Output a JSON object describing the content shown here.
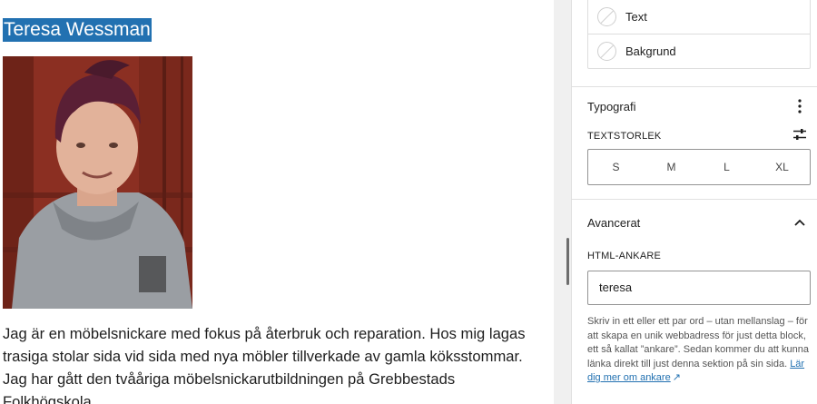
{
  "editor": {
    "heading": "Teresa Wessman",
    "photo_alt": "",
    "paragraph_lines": [
      "Jag är en möbelsnickare med fokus på återbruk och reparation. Hos mig lagas",
      "trasiga stolar sida vid sida med nya möbler tillverkade av gamla köksstommar.",
      "Jag har gått den tvååriga möbelsnickarutbildningen på Grebbestads",
      "Folkhögskola."
    ]
  },
  "sidebar": {
    "color": {
      "items": [
        {
          "label": "Text"
        },
        {
          "label": "Bakgrund"
        }
      ]
    },
    "typography": {
      "title": "Typografi",
      "font_size_label": "TEXTSTORLEK",
      "sizes": [
        "S",
        "M",
        "L",
        "XL"
      ]
    },
    "advanced": {
      "title": "Avancerat",
      "anchor_label": "HTML-ANKARE",
      "anchor_value": "teresa",
      "help_text": "Skriv in ett eller ett par ord – utan mellanslag – för att skapa en unik webbadress för just detta block, ett så kallat ”ankare”. Sedan kommer du att kunna länka direkt till just denna sektion på sin sida.",
      "help_link": "Lär dig mer om ankare",
      "help_link_icon": "↗"
    }
  },
  "colors": {
    "selection": "#2271b1",
    "link": "#2271b1"
  }
}
